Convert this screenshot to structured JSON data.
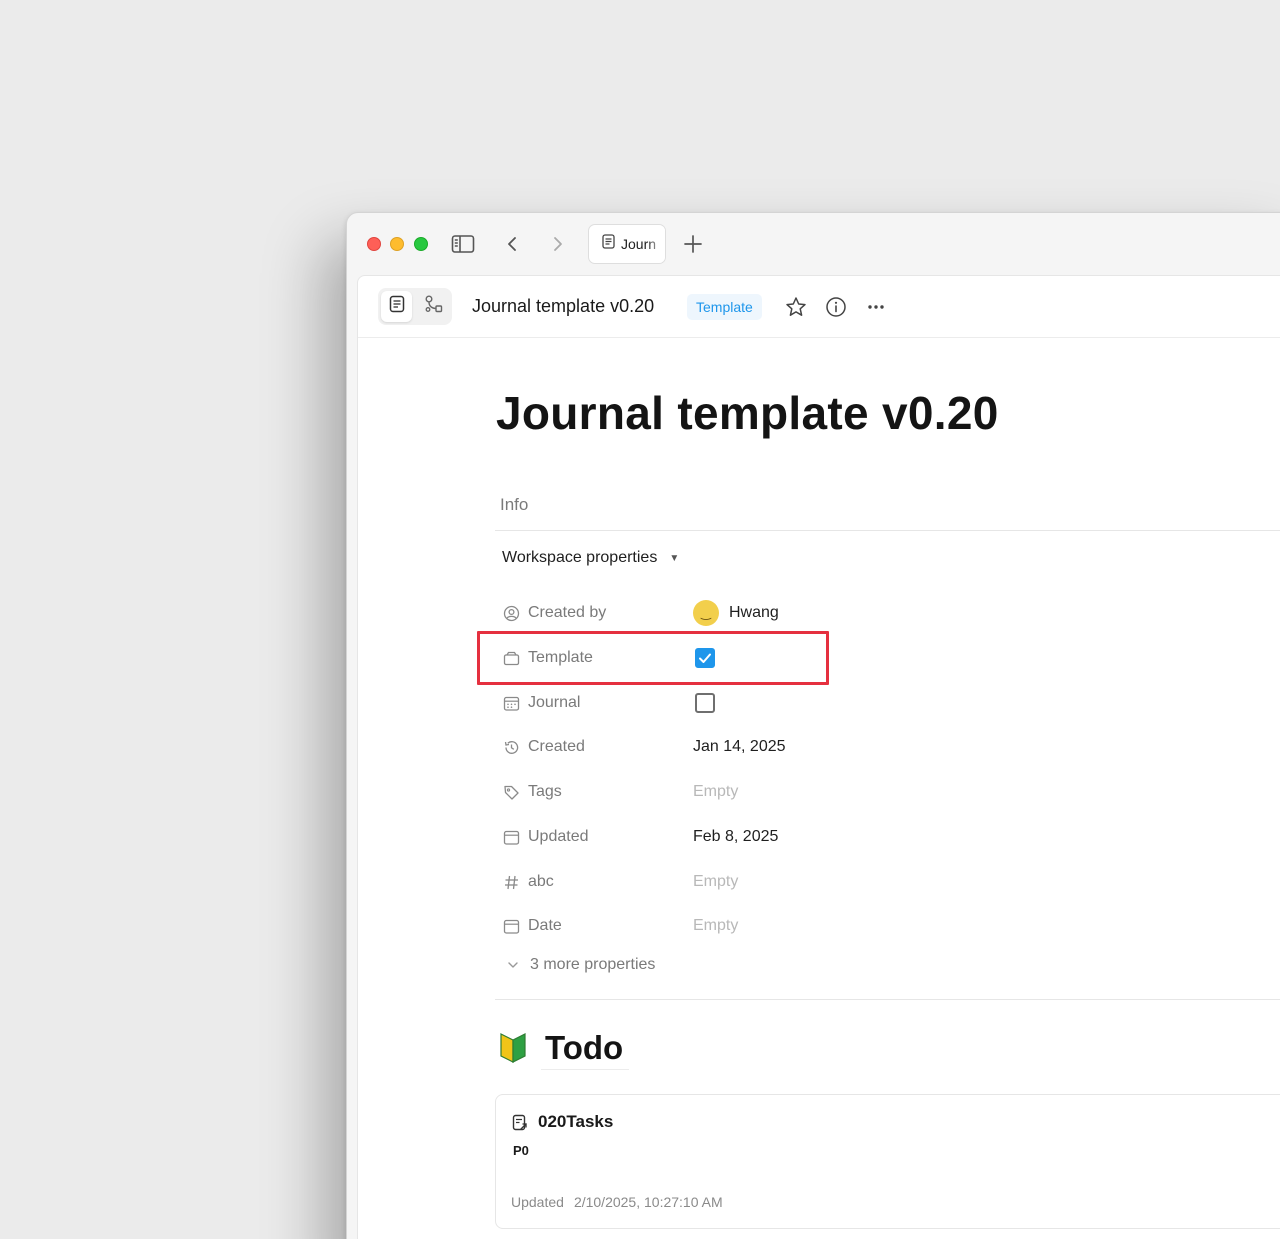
{
  "window": {
    "tab": {
      "label": "Journ"
    },
    "new_tab_icon": "plus-icon"
  },
  "header": {
    "title": "Journal template v0.20",
    "badge": "Template",
    "modes": [
      "page-mode-icon",
      "edgeless-mode-icon"
    ],
    "actions": [
      "star-icon",
      "info-icon",
      "more-icon"
    ]
  },
  "document": {
    "title": "Journal template v0.20",
    "info_label": "Info",
    "workspace_properties_label": "Workspace properties",
    "properties": [
      {
        "name": "Created by",
        "icon": "user-circle-icon",
        "value": "Hwang",
        "type": "user"
      },
      {
        "name": "Template",
        "icon": "template-icon",
        "value": true,
        "type": "checkbox"
      },
      {
        "name": "Journal",
        "icon": "journal-calendar-icon",
        "value": false,
        "type": "checkbox"
      },
      {
        "name": "Created",
        "icon": "history-icon",
        "value": "Jan 14, 2025",
        "type": "date"
      },
      {
        "name": "Tags",
        "icon": "tag-icon",
        "value": "Empty",
        "type": "empty"
      },
      {
        "name": "Updated",
        "icon": "calendar-icon",
        "value": "Feb 8, 2025",
        "type": "date"
      },
      {
        "name": "abc",
        "icon": "hash-icon",
        "value": "Empty",
        "type": "empty"
      },
      {
        "name": "Date",
        "icon": "calendar-icon",
        "value": "Empty",
        "type": "empty"
      }
    ],
    "more_properties": "3 more properties",
    "todo_heading": "Todo",
    "card": {
      "title": "020Tasks",
      "subtitle": "P0",
      "updated_label": "Updated",
      "updated_value": "2/10/2025, 10:27:10 AM"
    }
  },
  "colors": {
    "accent": "#1e96eb",
    "highlight": "#e5303f",
    "avatar": "#f2cf4c"
  }
}
